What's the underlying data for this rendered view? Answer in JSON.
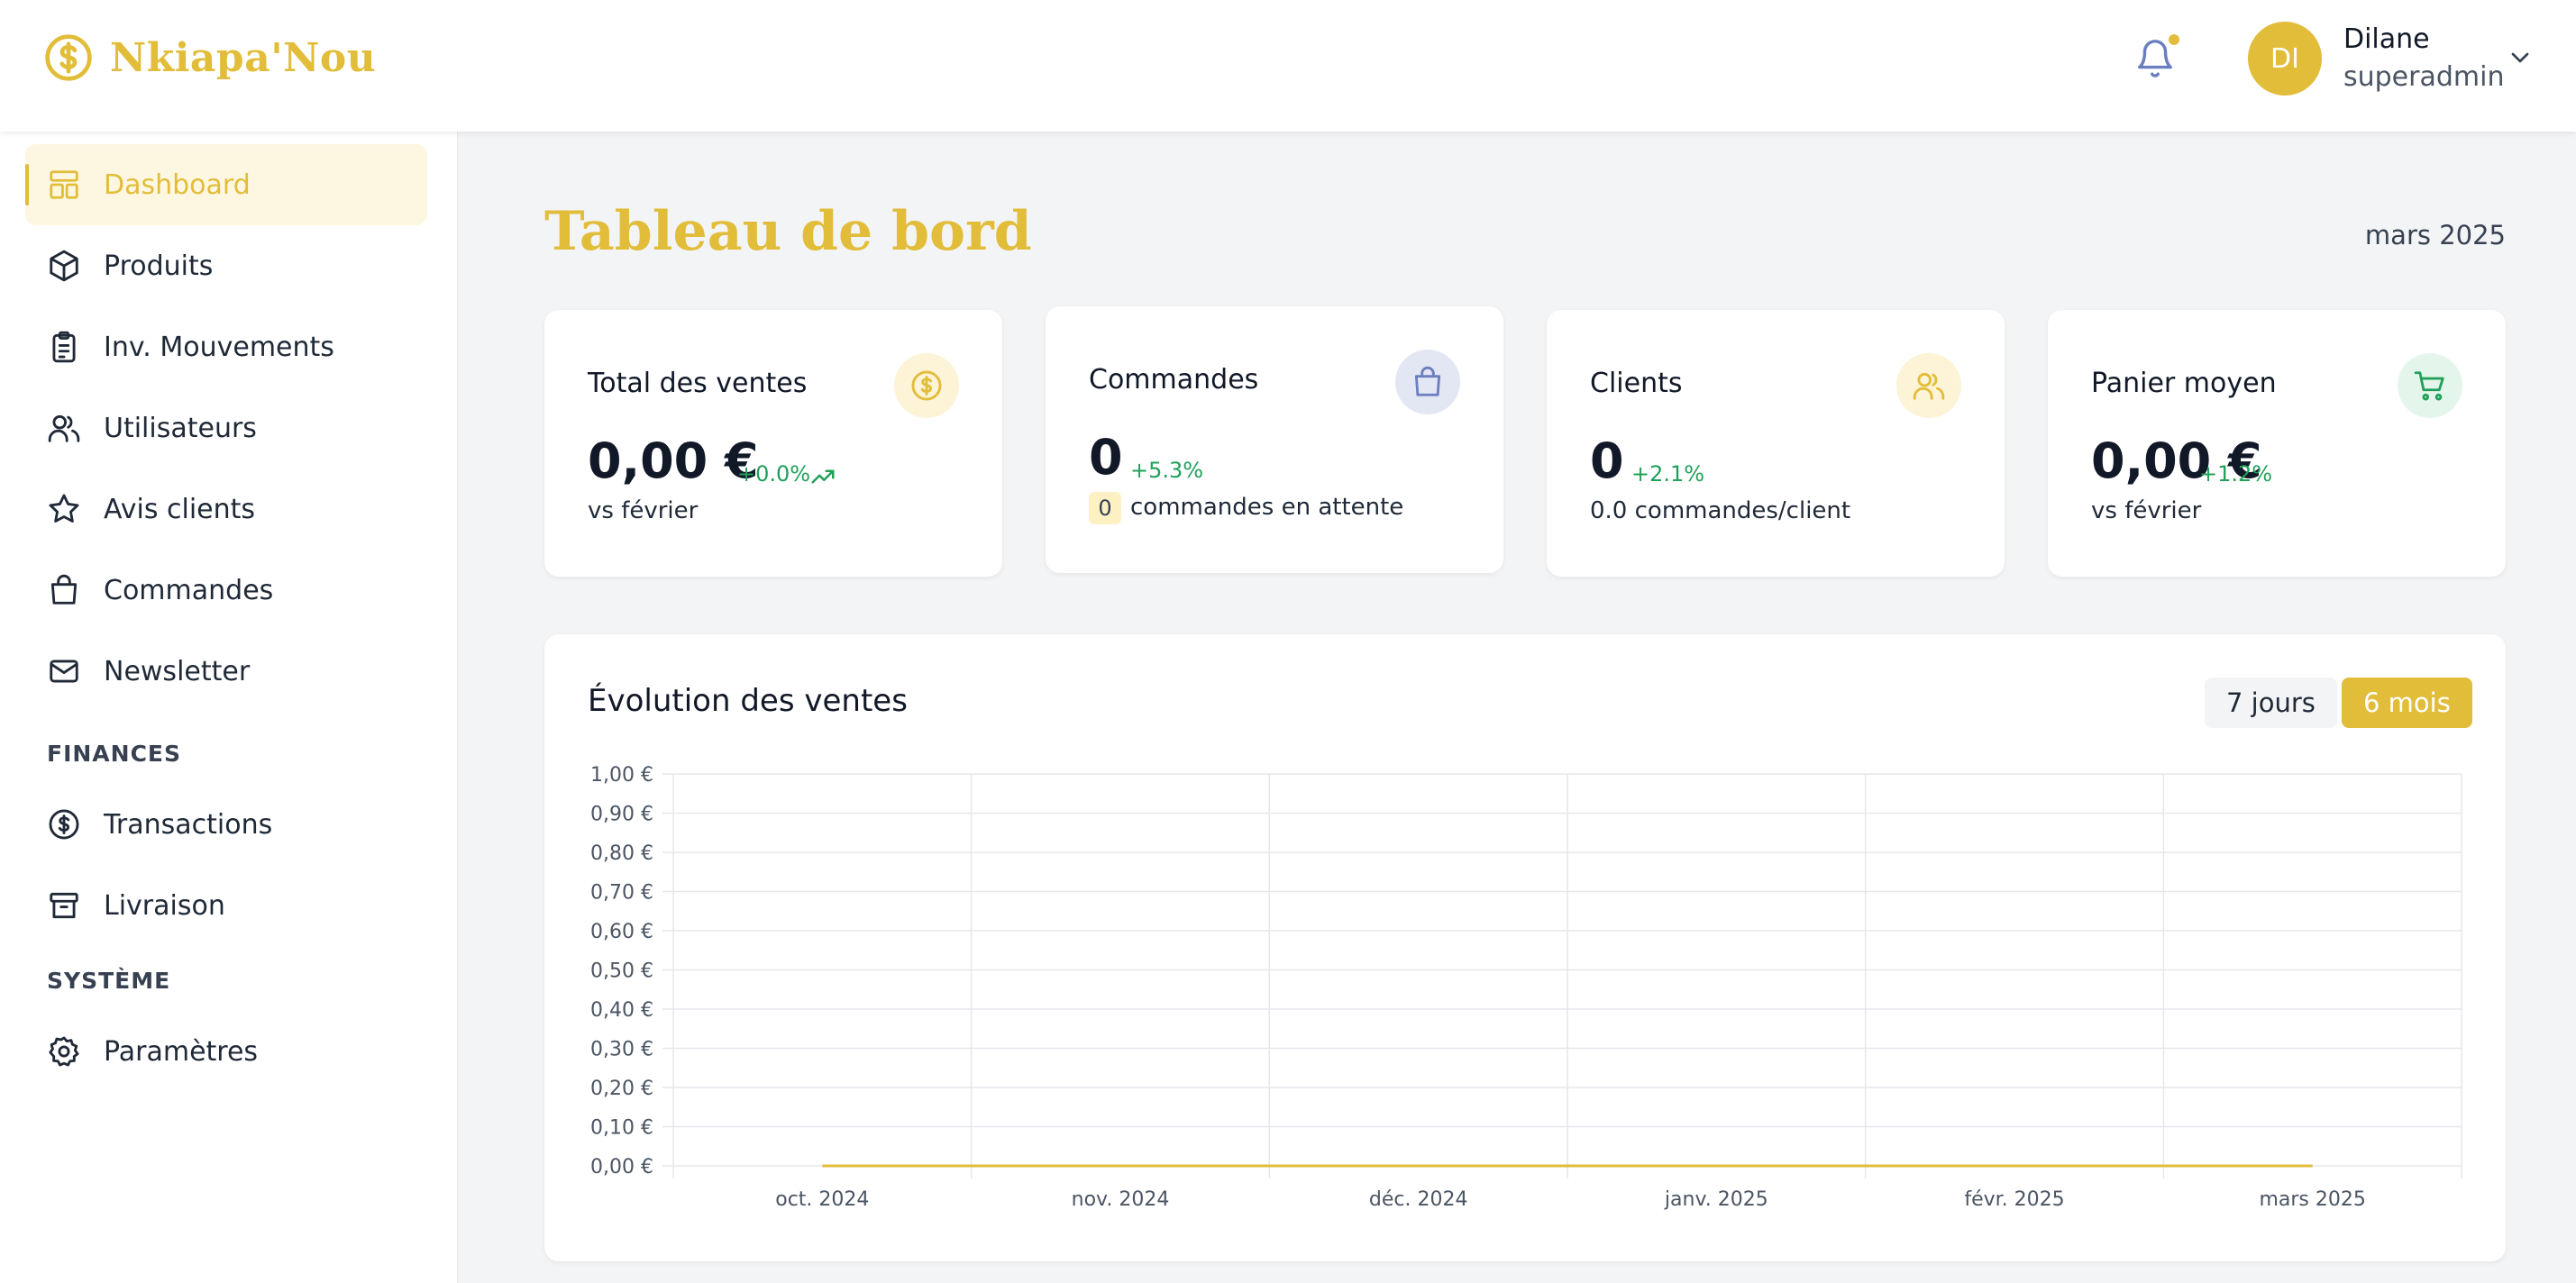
{
  "brand": {
    "name": "Nkiapa'Nou",
    "icon": "dollar-circle-icon",
    "color": "#e2bd3a"
  },
  "user": {
    "initials": "DI",
    "name": "Dilane",
    "role": "superadmin"
  },
  "sidebar": {
    "items": [
      {
        "label": "Dashboard",
        "icon": "dashboard-icon",
        "active": true
      },
      {
        "label": "Produits",
        "icon": "box-icon"
      },
      {
        "label": "Inv. Mouvements",
        "icon": "clipboard-icon"
      },
      {
        "label": "Utilisateurs",
        "icon": "users-icon"
      },
      {
        "label": "Avis clients",
        "icon": "star-icon"
      },
      {
        "label": "Commandes",
        "icon": "bag-icon"
      },
      {
        "label": "Newsletter",
        "icon": "mail-icon"
      }
    ],
    "finances": {
      "title": "FINANCES",
      "items": [
        {
          "label": "Transactions",
          "icon": "dollar-circle-icon"
        },
        {
          "label": "Livraison",
          "icon": "archive-icon"
        }
      ]
    },
    "system": {
      "title": "SYSTÈME",
      "items": [
        {
          "label": "Paramètres",
          "icon": "gear-icon"
        }
      ]
    }
  },
  "page": {
    "title": "Tableau de bord",
    "date": "mars 2025"
  },
  "cards": [
    {
      "title": "Total des ventes",
      "value": "0,00 €",
      "change": "+0.0%",
      "sub": "vs février",
      "icon": "dollar-circle-icon",
      "icon_bg": "#fdf3d6",
      "icon_color": "#e2bd3a"
    },
    {
      "title": "Commandes",
      "value": "0",
      "change": "+5.3%",
      "pending": "0",
      "sub": "commandes en attente",
      "icon": "bag-icon",
      "icon_bg": "#e3e7f3",
      "icon_color": "#6b7fc0"
    },
    {
      "title": "Clients",
      "value": "0",
      "change": "+2.1%",
      "sub": "0.0 commandes/client",
      "icon": "users-icon",
      "icon_bg": "#fdf3d6",
      "icon_color": "#e2bd3a"
    },
    {
      "title": "Panier moyen",
      "value": "0,00 €",
      "change": "+1.2%",
      "sub": "vs février",
      "icon": "cart-icon",
      "icon_bg": "#e4f6ec",
      "icon_color": "#22a05a"
    }
  ],
  "sales_chart": {
    "title": "Évolution des ventes",
    "range_buttons": [
      "7 jours",
      "6 mois"
    ],
    "selected_range": "6 mois"
  },
  "chart_data": {
    "type": "line",
    "title": "Évolution des ventes",
    "categories": [
      "oct. 2024",
      "nov. 2024",
      "déc. 2024",
      "janv. 2025",
      "févr. 2025",
      "mars 2025"
    ],
    "series": [
      {
        "values": [
          0,
          0,
          0,
          0,
          0,
          0
        ]
      }
    ],
    "y_ticks": [
      "0,00 €",
      "0,10 €",
      "0,20 €",
      "0,30 €",
      "0,40 €",
      "0,50 €",
      "0,60 €",
      "0,70 €",
      "0,80 €",
      "0,90 €",
      "1,00 €"
    ],
    "ylim": [
      0,
      1
    ],
    "grid": true
  }
}
